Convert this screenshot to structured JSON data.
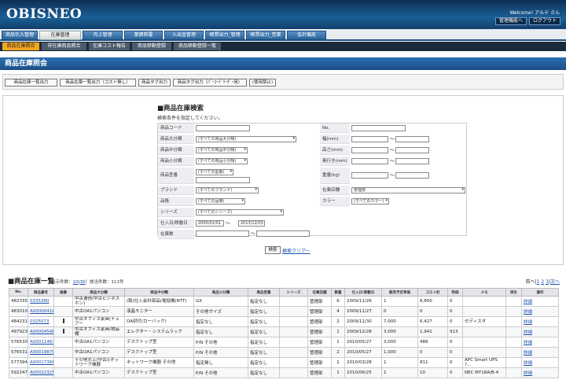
{
  "header": {
    "logo": "OBISNEO",
    "welcome": "Welcome! アルテ さん",
    "admin_btn": "管理機能へ",
    "logout_btn": "ログアウト"
  },
  "nav": [
    "商品仕入管理",
    "在庫管理",
    "売上管理",
    "業績照覆",
    "入出金管理",
    "帳票出力_管理",
    "帳票出力_営業",
    "会計機能"
  ],
  "subnav": [
    "商品在庫照合",
    "非在庫商品照合",
    "在庫コスト報告",
    "商品移動登録",
    "商品移動登録一覧"
  ],
  "page_title": "商品在庫照会",
  "actions": [
    "商品在庫一覧出力",
    "商品在庫一覧出力（コスト無し）",
    "商品タグ出力",
    "商品タグ出力（ﾊﾞｰｺｰﾄﾞﾘｰﾀﾞｰ用）",
    "(使用禁止)"
  ],
  "search": {
    "title": "■商品在庫検索",
    "desc": "検索条件を指定してください。",
    "labels": {
      "code": "商品コード",
      "no": "No.",
      "major": "商品大分類",
      "width": "幅(mm)",
      "middle": "商品中分類",
      "height": "高さ(mm)",
      "minor": "商品小分類",
      "depth": "奥行き(mm)",
      "model": "商品型番",
      "weight": "重量(kg)",
      "brand": "ブランド",
      "store": "在庫店舗",
      "item": "品格",
      "color": "カラー",
      "series": "シリーズ",
      "date": "仕入日/移動日",
      "shelf": "在庫数"
    },
    "values": {
      "major": "(すべての商品大分類)",
      "middle": "(すべての商品中分類)",
      "minor": "(すべての商品小分類)",
      "model": "(すべての型番)",
      "brand": "(すべてのブランド)",
      "store": "管理部",
      "item": "(すべての品格)",
      "color": "(すべてのカラー)",
      "series": "(すべてのシリーズ)",
      "date_from": "2005/01/01",
      "date_to": "2013/12/03"
    },
    "tilde": "〜",
    "search_btn": "検索",
    "clear_link": "検索クリアー"
  },
  "list": {
    "title": "■商品在庫一覧",
    "sub_prefix": "(表示件数：",
    "sub_link1": "10",
    "sub_sep": "|",
    "sub_link2": "30",
    "sub_suffix": "）該当件数：111件",
    "pager": {
      "next": "前へ",
      "sep": "|",
      "p1": "1",
      "p2": "2",
      "p3": "3",
      "last": "次へ"
    },
    "columns": [
      "No.",
      "商品番号",
      "画像",
      "商品大分類",
      "商品中分類",
      "商品小分類",
      "商品型番",
      "シリーズ",
      "在庫店舗",
      "数量",
      "仕入日/移動日",
      "販売予定単価",
      "コスト計",
      "特価",
      "メモ",
      "再生",
      "操作"
    ],
    "rows": [
      [
        "482335",
        "0335380",
        "",
        "中古通信(中古ビジネスホン)",
        "(製)仕入会計部品(電話機(NTT)",
        "GX",
        "指定なし",
        "",
        "管理部",
        "6",
        "2009/11/26",
        "1",
        "8,800",
        "0",
        "",
        "",
        "詳細"
      ],
      [
        "483010",
        "A00000418",
        "",
        "中古OA1パソコン",
        "液晶モニター",
        "その他サイズ",
        "指定なし",
        "",
        "管理部",
        "4",
        "2009/11/27",
        "0",
        "0",
        "0",
        "",
        "",
        "詳細"
      ],
      [
        "484231",
        "0325073",
        "bar",
        "中古オフィス家具(チェアー",
        "OA封付(ローバック)",
        "指定なし",
        "指定なし",
        "",
        "管理部",
        "2",
        "2009/11/30",
        "7,000",
        "6,427",
        "0",
        "セディスタ",
        "",
        "詳細"
      ],
      [
        "497923",
        "A00004548",
        "bar",
        "中古オフィス家具(物品棚",
        "エレクター・システムラック",
        "指定なし",
        "指定なし",
        "",
        "管理部",
        "1",
        "2009/12/28",
        "3,000",
        "1,941",
        "913",
        "",
        "",
        "詳細"
      ],
      [
        "576530",
        "A00011463",
        "",
        "中古OA1パソコン",
        "デスクトップ型",
        "P/N その他",
        "指定なし",
        "",
        "管理部",
        "1",
        "2010/05/27",
        "3,000",
        "486",
        "0",
        "",
        "",
        "詳細"
      ],
      [
        "576531",
        "A00019870",
        "",
        "中古OA1パソコン",
        "デスクトップ型",
        "P/N その他",
        "指定なし",
        "",
        "管理部",
        "2",
        "2010/05/27",
        "1,000",
        "0",
        "0",
        "",
        "",
        "詳細"
      ],
      [
        "577394",
        "A00017368",
        "",
        "その他売上(中古)(ネットワーク機器",
        "ネットワーク機器 その他",
        "指定無し",
        "指定なし",
        "",
        "管理部",
        "1",
        "2010/03/28",
        "1",
        "811",
        "0",
        "APC Smart UPS ?...",
        "",
        "詳細"
      ],
      [
        "592247",
        "A00022325",
        "",
        "中古OA1パソコン",
        "デスクトップ型",
        "P/N その他",
        "指定なし",
        "",
        "管理部",
        "1",
        "2010/06/25",
        "1",
        "10",
        "0",
        "NEC MY18A/B-4",
        "",
        "詳細"
      ]
    ]
  }
}
